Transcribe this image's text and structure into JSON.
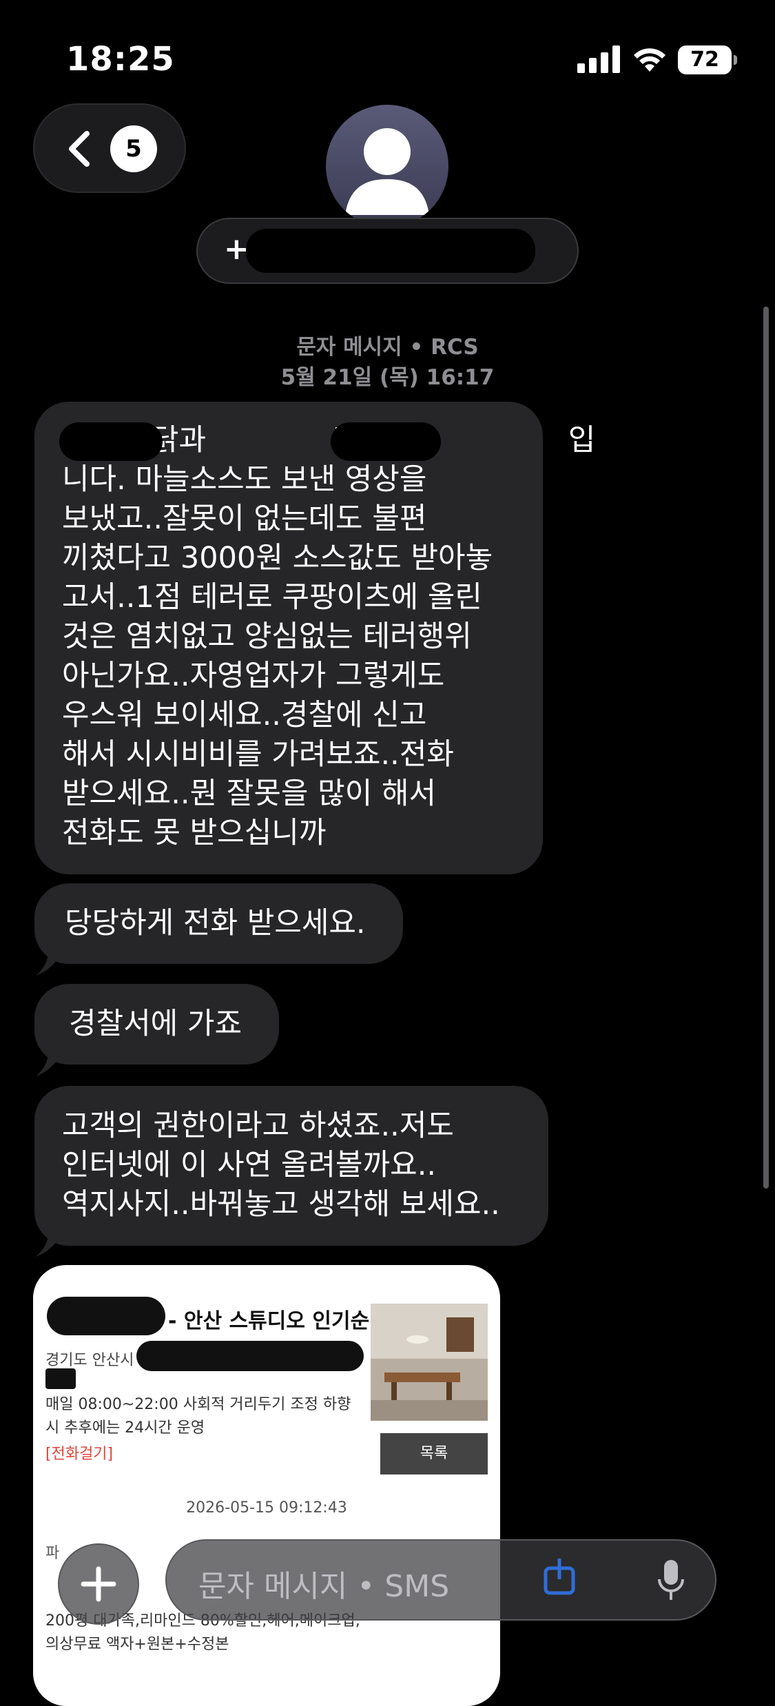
{
  "status_bar": {
    "time": "18:25",
    "battery": "72"
  },
  "header": {
    "back_badge": "5",
    "contact_prefix": "+",
    "avatar_icon": "person-silhouette-icon"
  },
  "thread": {
    "service_label": "문자 메시지 • RCS",
    "timestamp": "5월 21일 (목) 16:17"
  },
  "messages": [
    {
      "lines": [
        "닭과 관련없는 입",
        "니다. 마늘소스도 보낸 영상을",
        "보냈고..잘못이 없는데도 불편",
        "끼쳤다고 3000원 소스값도 받아놓",
        "고서..1점 테러로 쿠팡이츠에 올린",
        "것은 염치없고 양심없는 테러행위",
        "아닌가요..자영업자가 그렇게도",
        "우스워 보이세요..경찰에 신고",
        "해서 시시비비를 가려보죠..전화",
        "받으세요..뭔 잘못을 많이 해서",
        "전화도 못 받으십니까"
      ]
    },
    {
      "lines": [
        "당당하게 전화 받으세요."
      ]
    },
    {
      "lines": [
        "경찰서에 가죠"
      ]
    },
    {
      "lines": [
        "고객의 권한이라고 하셨죠..저도",
        "인터넷에 이 사연 올려볼까요..",
        "역지사지..바꿔놓고 생각해 보세요.."
      ]
    }
  ],
  "link_card": {
    "title": "- 안산 스튜디오 인기순",
    "address": "경기도 안산시",
    "hours": "매일 08:00~22:00 사회적 거리두기 조정 하향\n시 추후에는 24시간 운영",
    "call_link": "[전화걸기]",
    "list_button": "목록",
    "date": "2026-05-15 09:12:43",
    "second_prefix": "파",
    "second_desc": "200평 대가족,리마인드 80%할인,헤어,메이크업,\n의상무료 액자+원본+수정본"
  },
  "input_bar": {
    "placeholder": "문자 메시지 • SMS",
    "plus_icon": "plus-icon",
    "mic_icon": "microphone-icon"
  }
}
